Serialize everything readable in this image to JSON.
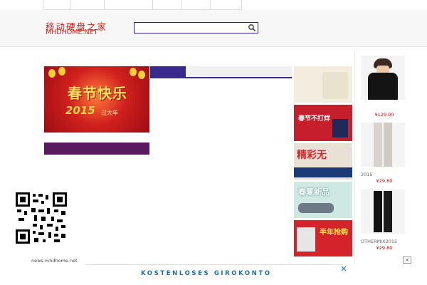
{
  "nav": {
    "items": [
      {
        "label": ""
      },
      {
        "label": ""
      },
      {
        "label": ""
      },
      {
        "label": ""
      },
      {
        "label": ""
      },
      {
        "label": ""
      }
    ]
  },
  "header": {
    "logo_cn": "移动硬盘之家",
    "logo_en": "MHDHOME.NET"
  },
  "search": {
    "placeholder": "",
    "value": ""
  },
  "banner": {
    "headline": "春节快乐",
    "year": "2015",
    "tail": "过大年"
  },
  "tabs": [
    {
      "label": ""
    },
    {
      "label": ""
    },
    {
      "label": ""
    },
    {
      "label": ""
    }
  ],
  "news_list": [
    {
      "text": ""
    },
    {
      "text": ""
    },
    {
      "text": ""
    },
    {
      "text": ""
    },
    {
      "text": ""
    },
    {
      "text": ""
    },
    {
      "text": ""
    },
    {
      "text": ""
    },
    {
      "text": ""
    },
    {
      "text": ""
    },
    {
      "text": ""
    },
    {
      "text": ""
    },
    {
      "text": ""
    },
    {
      "text": ""
    },
    {
      "text": ""
    },
    {
      "text": ""
    },
    {
      "text": ""
    },
    {
      "text": ""
    },
    {
      "text": ""
    },
    {
      "text": ""
    }
  ],
  "left_news": {
    "title": "",
    "rows": [
      {
        "text": ""
      },
      {
        "text": ""
      },
      {
        "text": ""
      },
      {
        "text": ""
      },
      {
        "text": ""
      },
      {
        "text": ""
      },
      {
        "text": ""
      },
      {
        "text": ""
      },
      {
        "text": ""
      },
      {
        "text": ""
      },
      {
        "text": ""
      }
    ]
  },
  "ads": [
    {
      "text": ""
    },
    {
      "text": "春节不打烊"
    },
    {
      "text": "精彩无"
    },
    {
      "text": "春夏新品"
    },
    {
      "text": "半年抢购"
    }
  ],
  "products": [
    {
      "name": "",
      "price": "¥129.00"
    },
    {
      "name": "2015",
      "price": "¥29.80"
    },
    {
      "name": "OTHERMIX2015",
      "price": "¥29.80"
    }
  ],
  "qr": {
    "caption": "",
    "url": "news.mhdhome.net"
  },
  "bottom_left": "",
  "bottom_ad": {
    "headline": "KOSTENLOSES GIROKONTO",
    "sub": ""
  },
  "colors": {
    "brand_red": "#d4241a",
    "accent_purple": "#3a2a8e",
    "header_bg": "#f7f7f7",
    "price_red": "#cc0000"
  }
}
